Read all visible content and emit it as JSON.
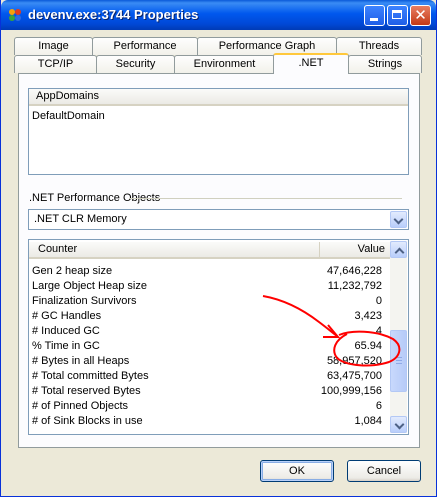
{
  "window": {
    "title": "devenv.exe:3744 Properties"
  },
  "tabs_row1": [
    "Image",
    "Performance",
    "Performance Graph",
    "Threads"
  ],
  "tabs_row2": [
    "TCP/IP",
    "Security",
    "Environment",
    ".NET",
    "Strings"
  ],
  "active_tab": ".NET",
  "appdomains": {
    "header": "AppDomains",
    "items": [
      "DefaultDomain"
    ]
  },
  "perf_objects": {
    "label": ".NET Performance Objects",
    "selected": ".NET CLR Memory"
  },
  "counters": {
    "headers": {
      "counter": "Counter",
      "value": "Value"
    },
    "rows": [
      {
        "name": "Gen 2 heap size",
        "value": "47,646,228"
      },
      {
        "name": "Large Object Heap size",
        "value": "11,232,792"
      },
      {
        "name": "Finalization Survivors",
        "value": "0"
      },
      {
        "name": "# GC Handles",
        "value": "3,423"
      },
      {
        "name": "# Induced GC",
        "value": "4"
      },
      {
        "name": "% Time in GC",
        "value": "65.94"
      },
      {
        "name": "# Bytes in all Heaps",
        "value": "58,957,520"
      },
      {
        "name": "# Total committed Bytes",
        "value": "63,475,700"
      },
      {
        "name": "# Total reserved Bytes",
        "value": "100,999,156"
      },
      {
        "name": "# of Pinned Objects",
        "value": "6"
      },
      {
        "name": "# of Sink Blocks in use",
        "value": "1,084"
      }
    ]
  },
  "buttons": {
    "ok": "OK",
    "cancel": "Cancel"
  },
  "colors": {
    "titlebar": "#0058ee",
    "annotation": "#ff0000",
    "active_tab_highlight": "#ffc83c"
  }
}
